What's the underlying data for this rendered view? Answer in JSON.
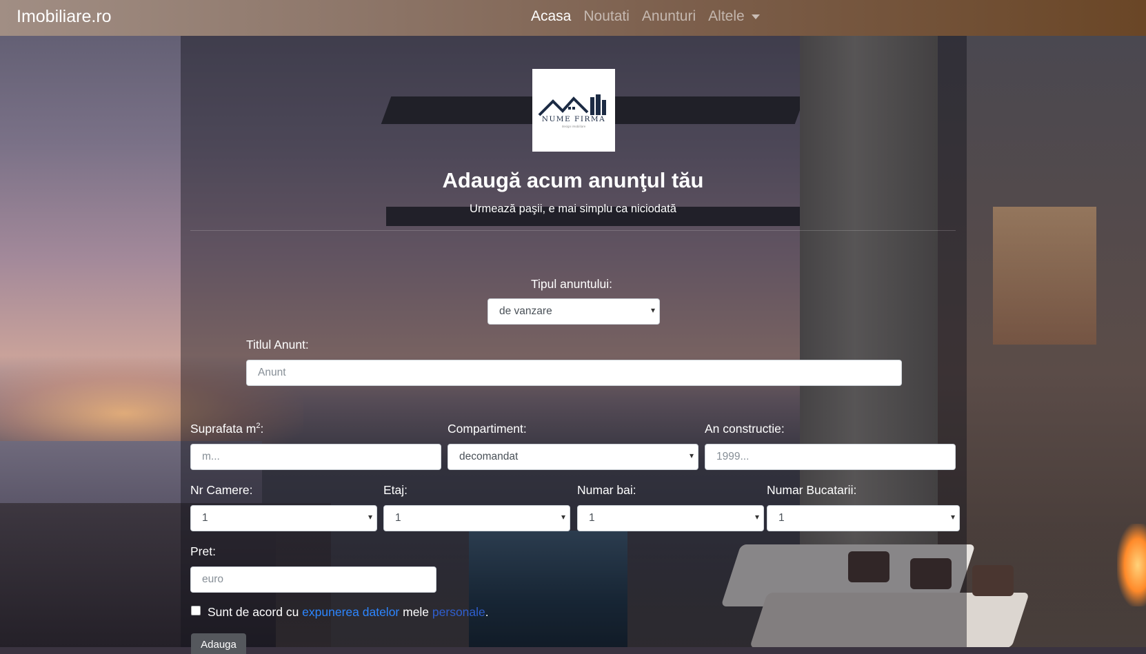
{
  "navbar": {
    "brand": "Imobiliare.ro",
    "items": [
      {
        "label": "Acasa",
        "active": true
      },
      {
        "label": "Noutati",
        "active": false
      },
      {
        "label": "Anunturi",
        "active": false
      },
      {
        "label": "Altele",
        "active": false,
        "dropdown": true
      }
    ]
  },
  "logo": {
    "text": "NUME FIRMA",
    "subtext": "design imobiliare"
  },
  "header": {
    "title": "Adaugă acum anunţul tău",
    "subtitle": "Urmează paşii, e mai simplu ca niciodată"
  },
  "form": {
    "tip_label": "Tipul anuntului:",
    "tip_value": "de vanzare",
    "titlu_label": "Titlul Anunt:",
    "titlu_placeholder": "Anunt",
    "suprafata_label": "Suprafata m",
    "suprafata_sup": "2",
    "suprafata_suffix": ":",
    "suprafata_placeholder": "m...",
    "compartiment_label": "Compartiment:",
    "compartiment_value": "decomandat",
    "an_label": "An constructie:",
    "an_placeholder": "1999...",
    "camere_label": "Nr Camere:",
    "camere_value": "1",
    "etaj_label": "Etaj:",
    "etaj_value": "1",
    "bai_label": "Numar bai:",
    "bai_value": "1",
    "bucatarii_label": "Numar Bucatarii:",
    "bucatarii_value": "1",
    "pret_label": "Pret:",
    "pret_placeholder": "euro",
    "consent_prefix": "Sunt de acord cu ",
    "consent_link1": "expunerea datelor",
    "consent_mid": " mele ",
    "consent_link2": "personale",
    "consent_suffix": ".",
    "submit_label": "Adauga"
  }
}
